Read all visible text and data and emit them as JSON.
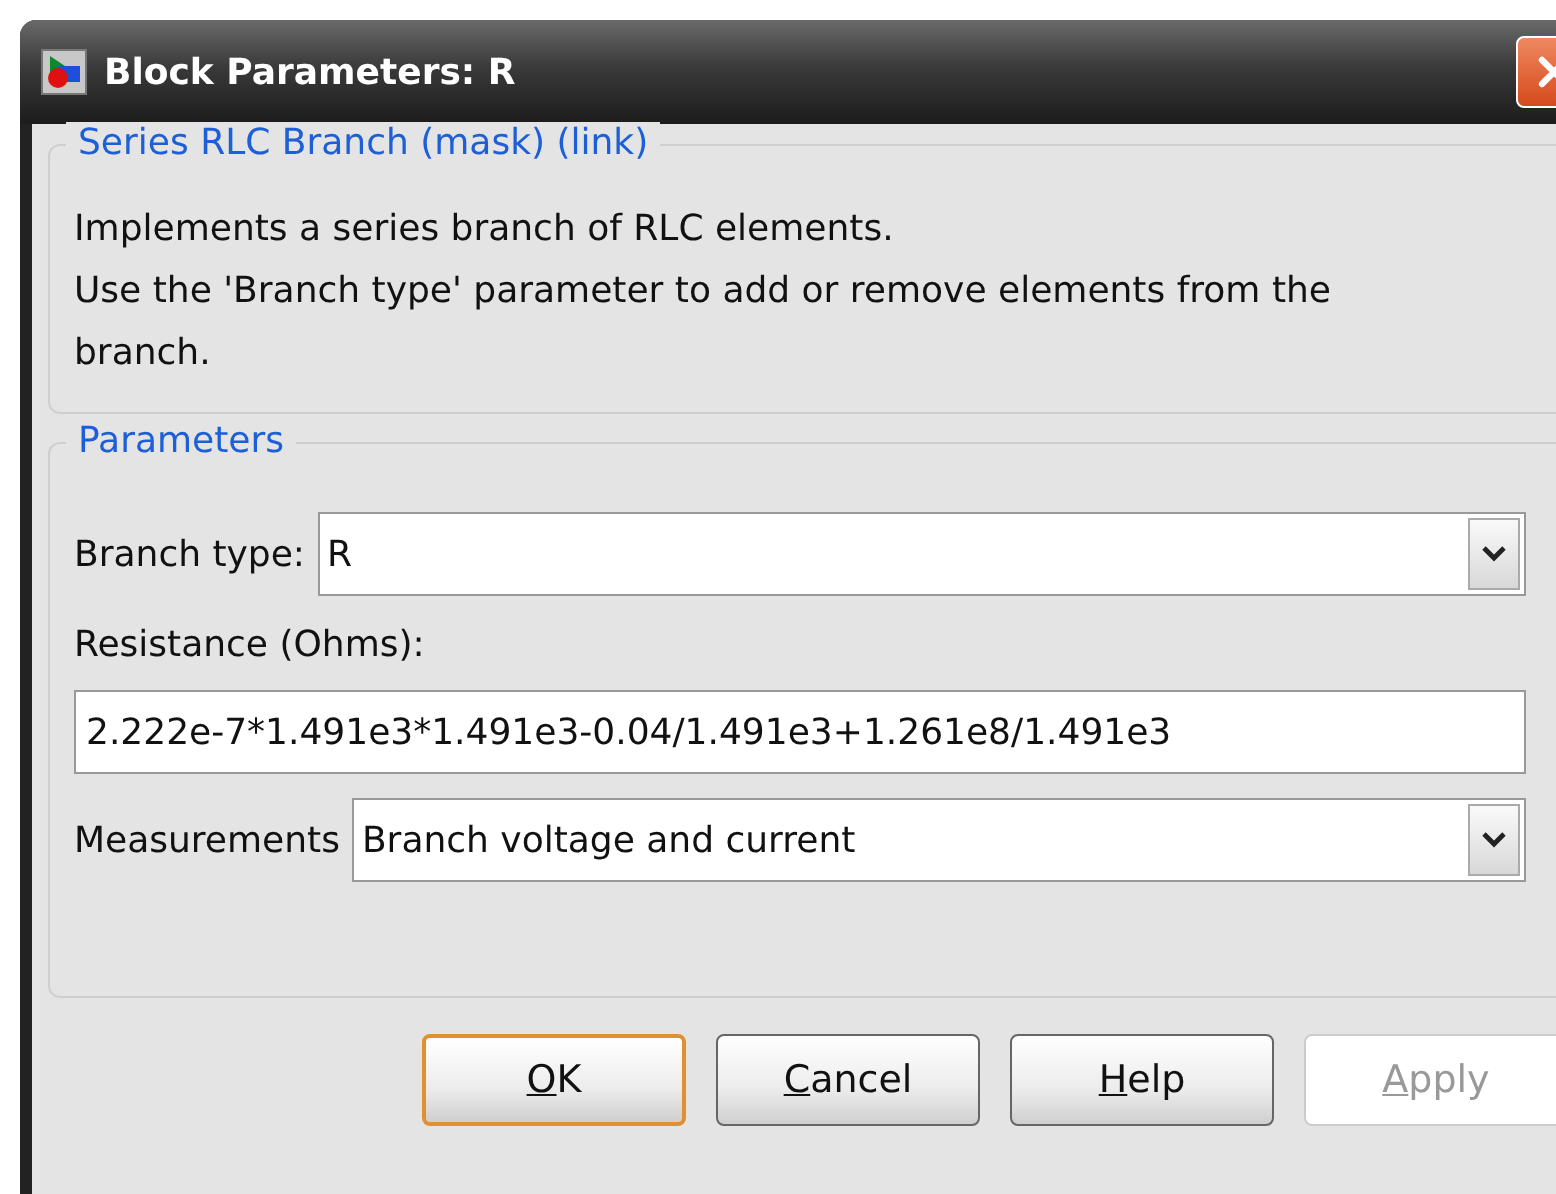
{
  "window": {
    "title": "Block Parameters: R"
  },
  "description": {
    "title": "Series RLC Branch (mask) (link)",
    "lines": [
      "Implements a series branch of RLC elements.",
      "Use the 'Branch type' parameter to add or remove elements from the branch."
    ]
  },
  "parameters": {
    "title": "Parameters",
    "fields": [
      {
        "kind": "dropdown",
        "label": "Branch type:",
        "value": "R"
      },
      {
        "kind": "text",
        "label": "Resistance (Ohms):",
        "value": "2.222e-7*1.491e3*1.491e3-0.04/1.491e3+1.261e8/1.491e3"
      },
      {
        "kind": "dropdown",
        "label": "Measurements",
        "value": "Branch voltage and current"
      }
    ]
  },
  "buttons": [
    {
      "key": "O",
      "rest": "K",
      "default": true,
      "disabled": false
    },
    {
      "key": "C",
      "rest": "ancel",
      "default": false,
      "disabled": false
    },
    {
      "key": "H",
      "rest": "elp",
      "default": false,
      "disabled": false
    },
    {
      "key": "A",
      "rest": "pply",
      "default": false,
      "disabled": true
    }
  ]
}
